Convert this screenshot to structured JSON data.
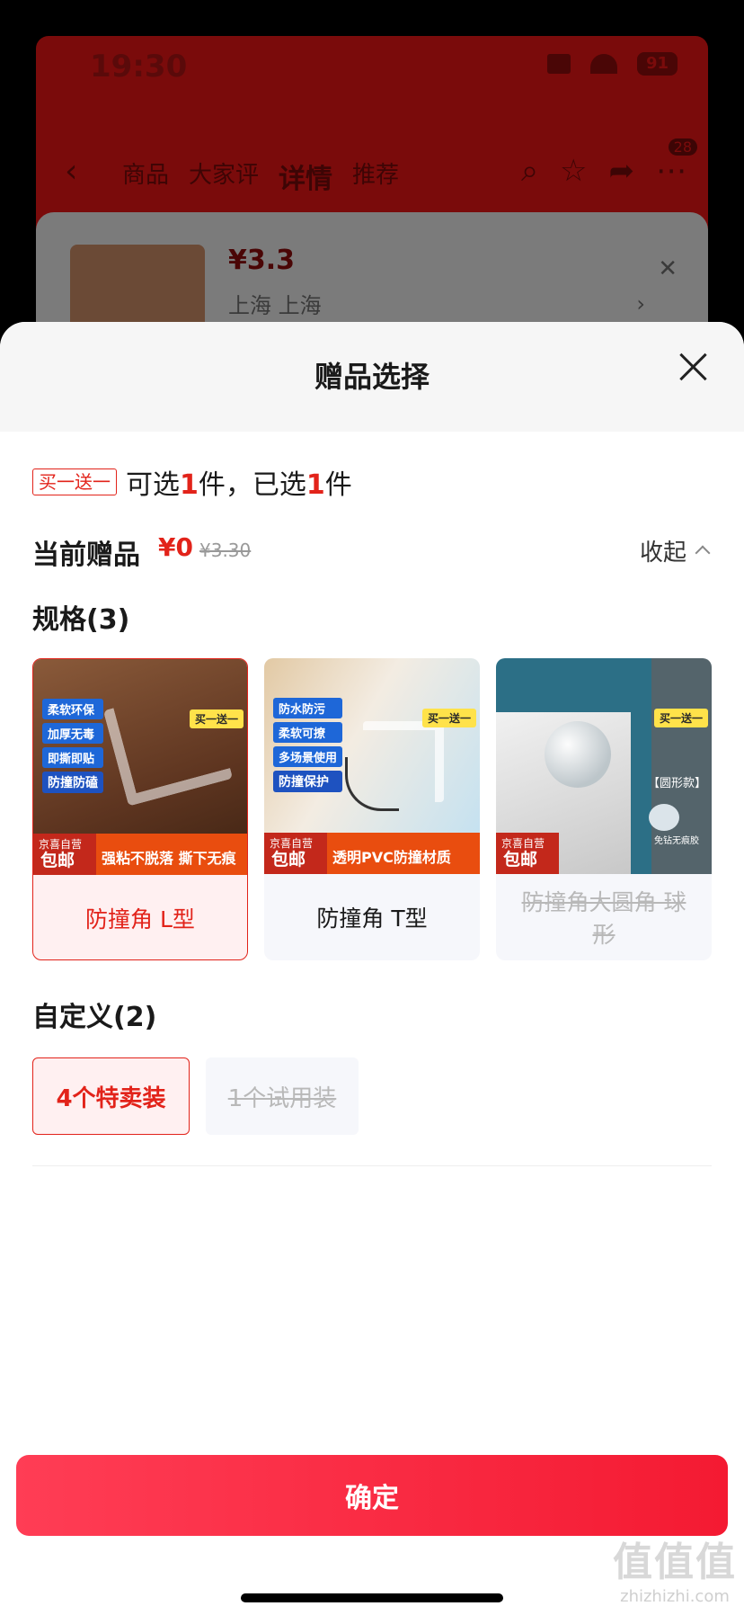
{
  "status_bar": {
    "time": "19:30",
    "battery": "91"
  },
  "nav": {
    "tabs": [
      "商品",
      "大家评",
      "详情",
      "推荐"
    ],
    "active_tab": "详情",
    "badge": "28"
  },
  "product_card": {
    "price": "¥3.3",
    "location": "上海  上海"
  },
  "sheet": {
    "title": "赠品选择",
    "promo_tag": "买一送一",
    "promo_text_prefix": "可选",
    "promo_text_count1": "1",
    "promo_text_mid": "件，已选",
    "promo_text_count2": "1",
    "promo_text_suffix": "件",
    "current_gift_label": "当前赠品",
    "current_gift_price": "¥0",
    "current_gift_original": "¥3.30",
    "collapse_label": "收起",
    "spec_section_title": "规格(3)",
    "specs": [
      {
        "label": "防撞角 L型",
        "state": "selected",
        "badges": [
          "柔软环保",
          "加厚无毒",
          "即撕即贴",
          "防撞防磕"
        ],
        "promo": "买一送一",
        "jd_top": "京喜自营",
        "jd_bottom": "包邮",
        "slogan": "强粘不脱落 撕下无痕"
      },
      {
        "label": "防撞角 T型",
        "state": "normal",
        "badges": [
          "防水防污",
          "柔软可撩",
          "多场景使用",
          "防撞保护"
        ],
        "promo": "买一送一",
        "jd_top": "京喜自营",
        "jd_bottom": "包邮",
        "slogan": "透明PVC防撞材质"
      },
      {
        "label": "防撞角大圆角 球形",
        "state": "disabled",
        "promo": "买一送一",
        "jd_top": "京喜自营",
        "jd_bottom": "包邮",
        "side_text": "【圆形款】",
        "side_note": "免钻无痕胶"
      }
    ],
    "custom_section_title": "自定义(2)",
    "custom_options": [
      {
        "label": "4个特卖装",
        "state": "selected"
      },
      {
        "label": "1个试用装",
        "state": "disabled"
      }
    ],
    "confirm_label": "确定"
  },
  "watermark": {
    "mark": "值值值",
    "url": "zhizhizhi.com"
  },
  "colors": {
    "accent": "#e2231a",
    "button_start": "#ff3d55",
    "button_end": "#f41a32"
  }
}
